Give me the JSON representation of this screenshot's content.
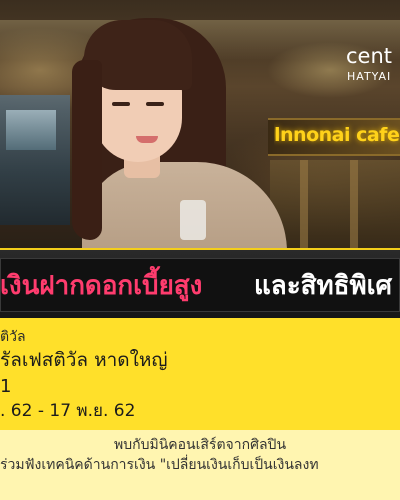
{
  "brand": {
    "name": "cent",
    "location": "HATYAI"
  },
  "photo": {
    "store_sign": "lnnonai cafe"
  },
  "headline": {
    "pink_text": "เงินฝากดอกเบี้ยสูง",
    "white_text": "และสิทธิพิเศ"
  },
  "event": {
    "label": "ติวัล",
    "venue": "รัลเฟสติวัล หาดใหญ่",
    "floor": "1",
    "dates": ". 62 - 17 พ.ย. 62"
  },
  "description": {
    "line1": "พบกับมินิคอนเสิร์ตจากศิลปิน",
    "line2": "ร่วมฟังเทคนิคด้านการเงิน \"เปลี่ยนเงินเก็บเป็นเงินลงท"
  },
  "colors": {
    "accent_yellow": "#ffe02a",
    "headline_pink": "#ff3c6e",
    "headline_bg": "#111111"
  }
}
